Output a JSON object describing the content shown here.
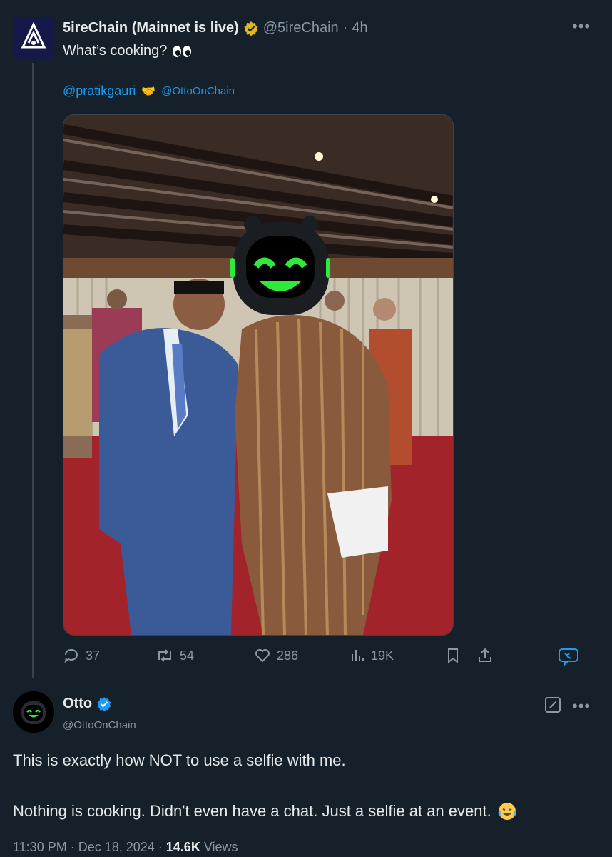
{
  "tweet": {
    "author_name": "5ireChain (Mainnet is live)",
    "handle": "@5ireChain",
    "time_ago": "4h",
    "text": "What’s cooking?",
    "mentions": [
      "@pratikgauri",
      "@OttoOnChain"
    ],
    "stats": {
      "replies": "37",
      "reposts": "54",
      "likes": "286",
      "views": "19K"
    }
  },
  "reply": {
    "author_name": "Otto",
    "handle": "@OttoOnChain",
    "line1": "This is exactly how NOT to use a selfie with me.",
    "line2": "Nothing is cooking. Didn't even have a chat. Just a selfie at an event.",
    "time": "11:30 PM · Dec 18, 2024 · ",
    "views_count": "14.6K",
    "views_label": " Views"
  },
  "icons": {
    "reply": "reply-icon",
    "repost": "repost-icon",
    "like": "heart-icon",
    "views": "views-icon",
    "bookmark": "bookmark-icon",
    "share": "share-icon",
    "grok": "grok-icon",
    "more": "more-icon",
    "verified_gold": "verified-gold-badge-icon",
    "verified_blue": "verified-blue-badge-icon"
  },
  "colors": {
    "background": "#15202b",
    "link": "#1d9bf0",
    "muted": "#8b98a5",
    "text": "#e7e9ea",
    "gold_badge": "#e2b719"
  }
}
